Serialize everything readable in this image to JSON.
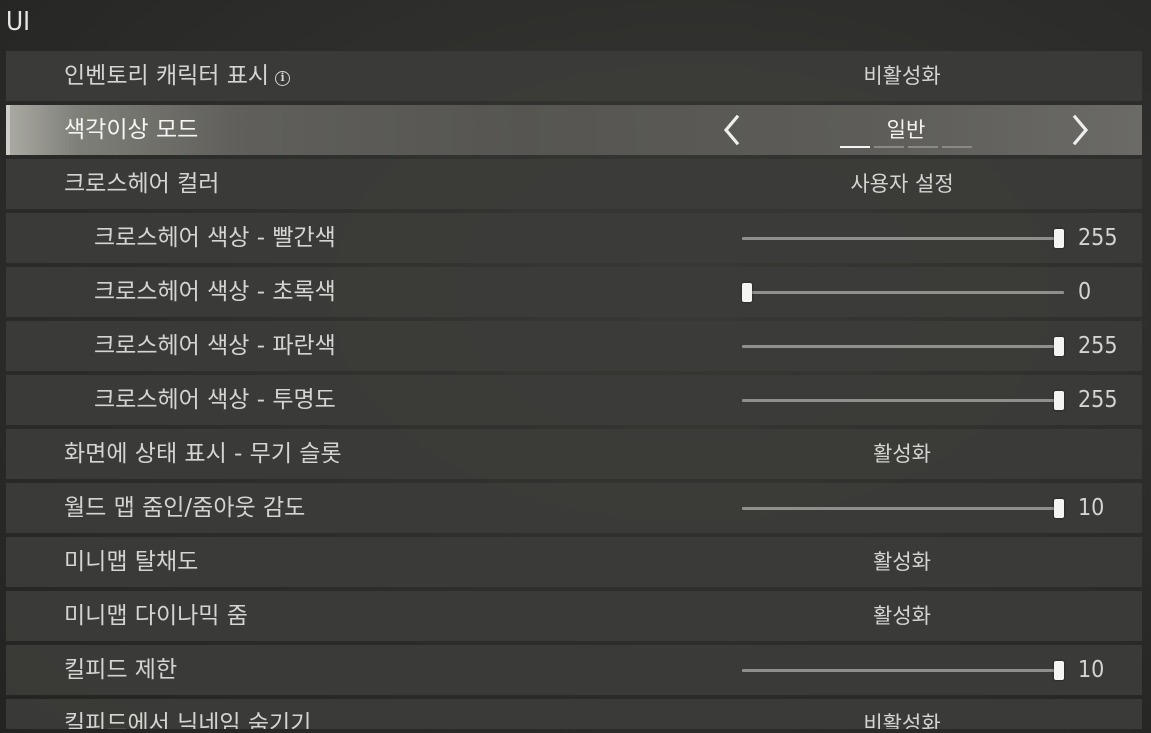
{
  "section_title": "UI",
  "rows": [
    {
      "id": "inventory-character",
      "label": "인벤토리 캐릭터 표시",
      "info_icon": "info-icon",
      "type": "value",
      "value": "비활성화"
    },
    {
      "id": "colorblind-mode",
      "label": "색각이상 모드",
      "type": "selector",
      "value": "일반",
      "page_index": 0,
      "page_count": 4
    },
    {
      "id": "crosshair-color",
      "label": "크로스헤어 컬러",
      "type": "value",
      "value": "사용자 설정"
    },
    {
      "id": "crosshair-red",
      "label": "크로스헤어 색상 - 빨간색",
      "type": "slider",
      "sub": true,
      "value": "255",
      "fraction": 1.0
    },
    {
      "id": "crosshair-green",
      "label": "크로스헤어 색상 - 초록색",
      "type": "slider",
      "sub": true,
      "value": "0",
      "fraction": 0.0
    },
    {
      "id": "crosshair-blue",
      "label": "크로스헤어 색상 - 파란색",
      "type": "slider",
      "sub": true,
      "value": "255",
      "fraction": 1.0
    },
    {
      "id": "crosshair-alpha",
      "label": "크로스헤어 색상 - 투명도",
      "type": "slider",
      "sub": true,
      "value": "255",
      "fraction": 1.0
    },
    {
      "id": "weapon-slot-status",
      "label": "화면에 상태 표시 - 무기 슬롯",
      "type": "value",
      "value": "활성화"
    },
    {
      "id": "worldmap-zoom-sensitivity",
      "label": "월드 맵 줌인/줌아웃 감도",
      "type": "slider",
      "value": "10",
      "fraction": 1.0
    },
    {
      "id": "minimap-saturation",
      "label": "미니맵 탈채도",
      "type": "value",
      "value": "활성화"
    },
    {
      "id": "minimap-dynamic-zoom",
      "label": "미니맵 다이나믹 줌",
      "type": "value",
      "value": "활성화"
    },
    {
      "id": "killfeed-limit",
      "label": "킬피드 제한",
      "type": "slider",
      "value": "10",
      "fraction": 1.0
    },
    {
      "id": "killfeed-hide-nickname",
      "label": "킬피드에서 닉네임 숨기기",
      "type": "value",
      "value": "비활성화",
      "cut": true
    }
  ]
}
